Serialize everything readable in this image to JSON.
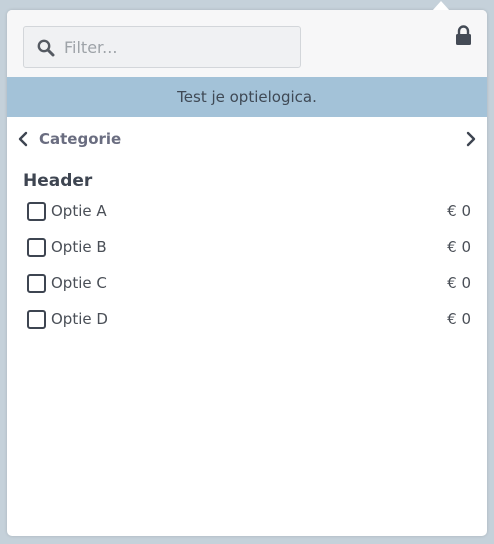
{
  "filter": {
    "placeholder": "Filter..."
  },
  "banner": {
    "text": "Test je optielogica."
  },
  "category": {
    "label": "Categorie"
  },
  "section": {
    "header": "Header"
  },
  "options": [
    {
      "label": "Optie A",
      "price": "€ 0",
      "checked": false
    },
    {
      "label": "Optie B",
      "price": "€ 0",
      "checked": false
    },
    {
      "label": "Optie C",
      "price": "€ 0",
      "checked": false
    },
    {
      "label": "Optie D",
      "price": "€ 0",
      "checked": false
    }
  ],
  "icons": {
    "search": "search-icon",
    "lock": "lock-icon",
    "back": "chevron-left-icon",
    "next": "chevron-right-icon"
  },
  "colors": {
    "banner_bg": "#a3c2d8",
    "accent_text": "#6a6d80",
    "page_bg": "#c5d1da"
  }
}
